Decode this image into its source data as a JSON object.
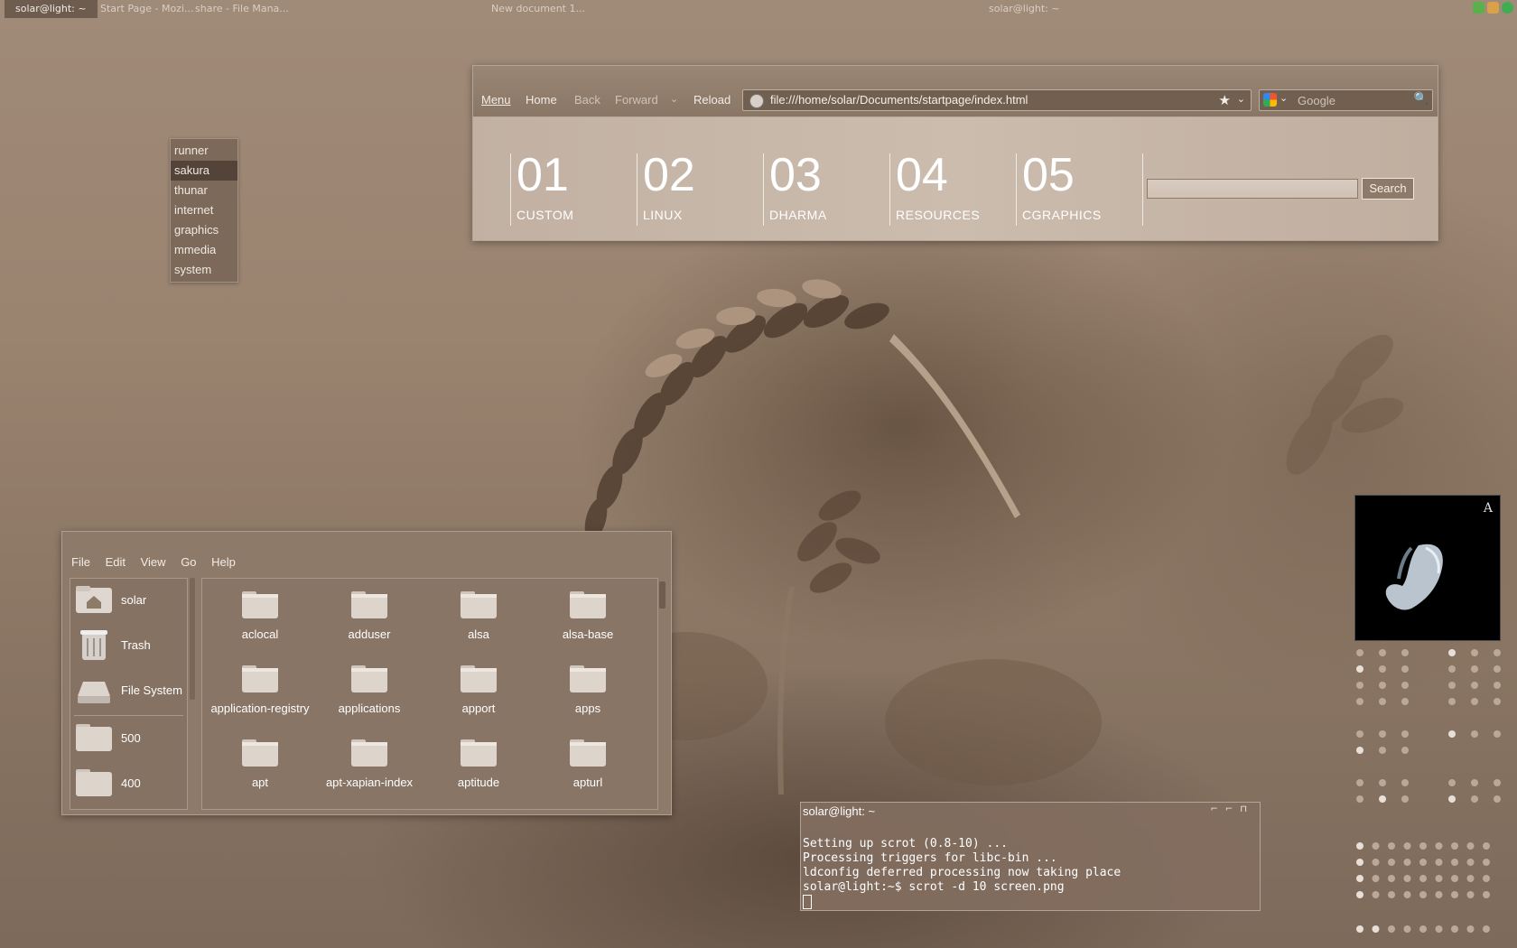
{
  "taskbar": {
    "tasks": [
      "solar@light: ~",
      "Start Page - Mozi...",
      "share - File Mana...",
      "New document 1...",
      "solar@light: ~"
    ]
  },
  "runner_menu": {
    "items": [
      "runner",
      "sakura",
      "thunar",
      "internet",
      "graphics",
      "mmedia",
      "system"
    ],
    "selected": "sakura"
  },
  "browser": {
    "menu_label": "Menu",
    "home_label": "Home",
    "back_label": "Back",
    "forward_label": "Forward",
    "reload_label": "Reload",
    "url": "file:///home/solar/Documents/startpage/index.html",
    "search_placeholder": "Google",
    "startpage": {
      "tiles": [
        {
          "num": "01",
          "label": "CUSTOM"
        },
        {
          "num": "02",
          "label": "LINUX"
        },
        {
          "num": "03",
          "label": "DHARMA"
        },
        {
          "num": "04",
          "label": "RESOURCES"
        },
        {
          "num": "05",
          "label": "CGRAPHICS"
        }
      ],
      "search_button": "Search"
    }
  },
  "file_manager": {
    "menus": [
      "File",
      "Edit",
      "View",
      "Go",
      "Help"
    ],
    "sidebar": [
      "solar",
      "Trash",
      "File System",
      "500",
      "400"
    ],
    "folders": [
      "aclocal",
      "adduser",
      "alsa",
      "alsa-base",
      "application-registry",
      "applications",
      "apport",
      "apps",
      "apt",
      "apt-xapian-index",
      "aptitude",
      "apturl"
    ]
  },
  "terminal": {
    "title": "solar@light: ~",
    "lines": [
      "Setting up scrot (0.8-10) ...",
      "Processing triggers for libc-bin ...",
      "ldconfig deferred processing now taking place",
      "solar@light:~$ scrot -d 10 screen.png"
    ]
  },
  "album": {
    "mark": "A"
  },
  "colors": {
    "accent": "#8e7a69",
    "selection": "#5a4638"
  }
}
